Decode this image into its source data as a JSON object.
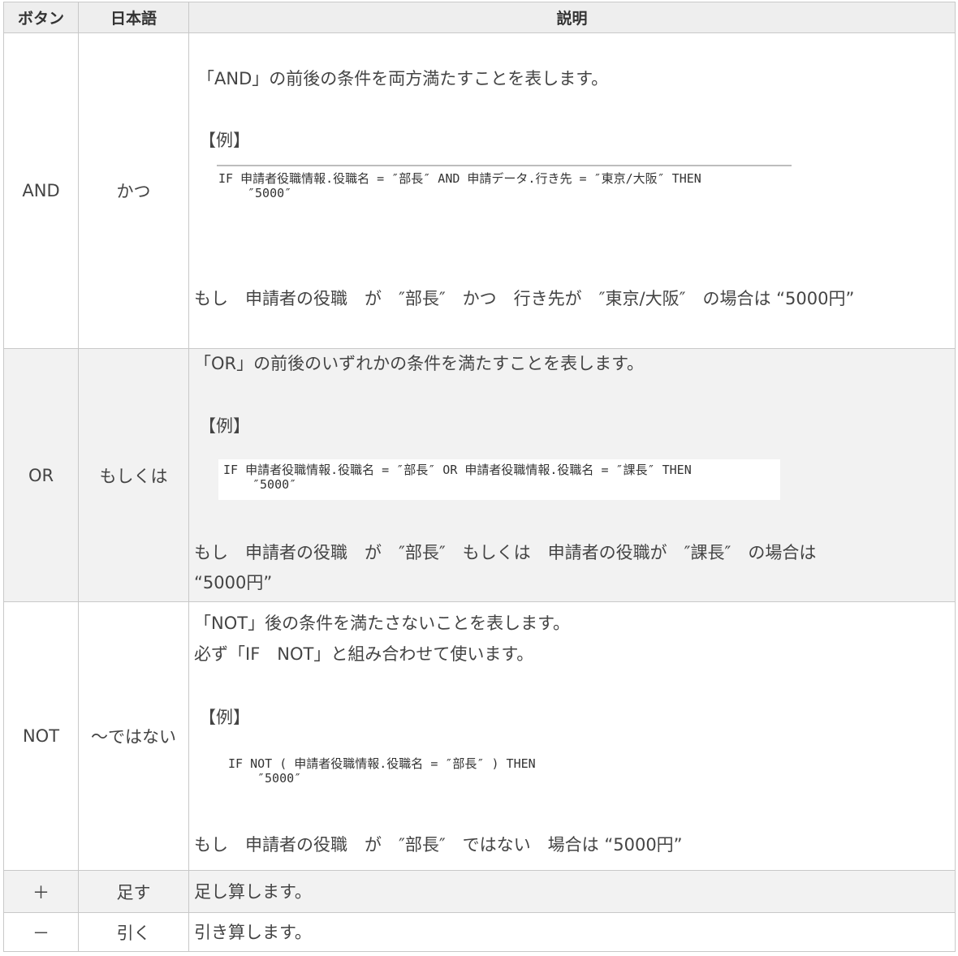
{
  "header": {
    "col1": "ボタン",
    "col2": "日本語",
    "col3": "説明"
  },
  "rows": [
    {
      "button": "AND",
      "japanese": "かつ",
      "desc": "「AND」の前後の条件を両方満たすことを表します。",
      "example_label": "【例】",
      "code_line1": "IF 申請者役職情報.役職名 = ″部長″ AND 申請データ.行き先 = ″東京/大阪″ THEN",
      "code_line2": "″5000″",
      "explain": "もし　申請者の役職　が　″部長″　かつ　行き先が　″東京/大阪″　の場合は “5000円”"
    },
    {
      "button": "OR",
      "japanese": "もしくは",
      "desc": "「OR」の前後のいずれかの条件を満たすことを表します。",
      "example_label": "【例】",
      "code_line1": "IF 申請者役職情報.役職名 = ″部長″ OR 申請者役職情報.役職名 = ″課長″ THEN",
      "code_line2": "″5000″",
      "explain_line1": "もし　申請者の役職　が　″部長″　もしくは　申請者の役職が　″課長″　の場合は",
      "explain_line2": "“5000円”"
    },
    {
      "button": "NOT",
      "japanese": "～ではない",
      "desc_line1": "「NOT」後の条件を満たさないことを表します。",
      "desc_line2": "必ず「IF　NOT」と組み合わせて使います。",
      "example_label": "【例】",
      "code_line1": "IF NOT ( 申請者役職情報.役職名 = ″部長″ ) THEN",
      "code_line2": "″5000″",
      "explain": "もし　申請者の役職　が　″部長″　ではない　場合は “5000円”"
    },
    {
      "button": "＋",
      "japanese": "足す",
      "desc": "足し算します。"
    },
    {
      "button": "－",
      "japanese": "引く",
      "desc": "引き算します。"
    }
  ]
}
